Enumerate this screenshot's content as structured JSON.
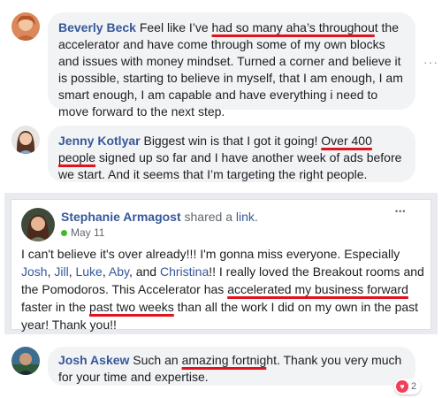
{
  "comment1": {
    "name": "Beverly Beck",
    "text_pre": " Feel like I’ve ",
    "text_ul": "had so many aha’s throughou",
    "text_post": "t the accelerator and have come through some of my own blocks and issues with money mindset. Turned a corner and believe it is possible, starting to believe in myself, that I am enough, I am smart enough, I am capable and have everything i need to move forward to the next step."
  },
  "comment2": {
    "name": "Jenny Kotlyar",
    "text_pre": " Biggest win is that I got it going! ",
    "text_ul": "Over 400 people",
    "text_post": " signed up so far and I have another week of ads before we start. And it seems that I’m targeting the right people."
  },
  "post": {
    "author": "Stephanie Armagost",
    "action": " shared a ",
    "action_link": "link.",
    "date": "May 11",
    "body_1": "I can't believe it's over already!!! I'm gonna miss everyone. Especially ",
    "mention_josh": "Josh",
    "sep1": ", ",
    "mention_jill": "Jill",
    "sep2": ", ",
    "mention_luke": "Luke",
    "sep3": ", ",
    "mention_aby": "Aby",
    "sep4": ", and ",
    "mention_christina": "Christina",
    "body_2": "!! I really loved the Breakout rooms and the Pomodoros. This Accelerator has ",
    "ul_1": "accelerated my business forward",
    "body_3": " faster in the ",
    "ul_2": "past two weeks",
    "body_4": " than all the work I did on my own in the past year! Thank you!!",
    "more": "•••"
  },
  "comment3": {
    "name": "Josh Askew",
    "text_pre": " Such an ",
    "text_ul": "amazing fortnig",
    "text_post": "ht. Thank you very much for your time and expertise.",
    "reaction_count": "2"
  },
  "more_dots": "···",
  "colors": {
    "link": "#365899",
    "underline": "#e0141e",
    "bubble": "#f2f3f5"
  }
}
